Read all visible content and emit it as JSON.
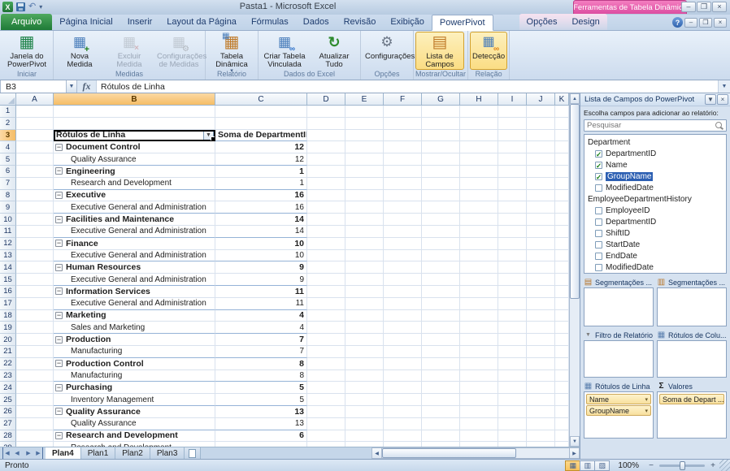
{
  "titlebar": {
    "title": "Pasta1 - Microsoft Excel",
    "contextual_label": "Ferramentas de Tabela Dinâmica"
  },
  "tabs": {
    "file_label": "Arquivo",
    "items": [
      "Página Inicial",
      "Inserir",
      "Layout da Página",
      "Fórmulas",
      "Dados",
      "Revisão",
      "Exibição",
      "PowerPivot"
    ],
    "active": "PowerPivot",
    "contextual_items": [
      "Opções",
      "Design"
    ]
  },
  "ribbon": {
    "groups": [
      {
        "label": "Iniciar",
        "buttons": [
          {
            "label": "Janela do PowerPivot",
            "icon": "powerpivot-window-icon"
          }
        ]
      },
      {
        "label": "Medidas",
        "buttons": [
          {
            "label": "Nova Medida",
            "icon": "new-measure-icon"
          },
          {
            "label": "Excluir Medida",
            "icon": "delete-measure-icon",
            "disabled": true
          },
          {
            "label": "Configurações de Medidas",
            "icon": "measure-settings-icon",
            "disabled": true
          }
        ]
      },
      {
        "label": "Relatório",
        "buttons": [
          {
            "label": "Tabela Dinâmica",
            "icon": "pivot-table-icon",
            "dropdown": true
          }
        ]
      },
      {
        "label": "Dados do Excel",
        "buttons": [
          {
            "label": "Criar Tabela Vinculada",
            "icon": "linked-table-icon"
          },
          {
            "label": "Atualizar Tudo",
            "icon": "refresh-all-icon"
          }
        ]
      },
      {
        "label": "Opções",
        "buttons": [
          {
            "label": "Configurações",
            "icon": "settings-icon"
          }
        ]
      },
      {
        "label": "Mostrar/Ocultar",
        "buttons": [
          {
            "label": "Lista de Campos",
            "icon": "field-list-icon",
            "active": true
          }
        ]
      },
      {
        "label": "Relação",
        "buttons": [
          {
            "label": "Detecção",
            "icon": "detection-icon",
            "active": true
          }
        ]
      }
    ]
  },
  "formula_bar": {
    "name_box": "B3",
    "fx_label": "fx",
    "value": "Rótulos de Linha"
  },
  "grid": {
    "columns": [
      "A",
      "B",
      "C",
      "D",
      "E",
      "F",
      "G",
      "H",
      "I",
      "J",
      "K"
    ],
    "selected_column": "B",
    "selected_row": 3,
    "visible_rows": 29,
    "pivot": {
      "header_row": 3,
      "header": {
        "row_label": "Rótulos de Linha",
        "value_label": "Soma de DepartmentID"
      },
      "rows": [
        {
          "type": "group",
          "label": "Document Control",
          "value": "12"
        },
        {
          "type": "detail",
          "label": "Quality Assurance",
          "value": "12"
        },
        {
          "type": "group",
          "label": "Engineering",
          "value": "1"
        },
        {
          "type": "detail",
          "label": "Research and Development",
          "value": "1"
        },
        {
          "type": "group",
          "label": "Executive",
          "value": "16"
        },
        {
          "type": "detail",
          "label": "Executive General and Administration",
          "value": "16"
        },
        {
          "type": "group",
          "label": "Facilities and Maintenance",
          "value": "14"
        },
        {
          "type": "detail",
          "label": "Executive General and Administration",
          "value": "14"
        },
        {
          "type": "group",
          "label": "Finance",
          "value": "10"
        },
        {
          "type": "detail",
          "label": "Executive General and Administration",
          "value": "10"
        },
        {
          "type": "group",
          "label": "Human Resources",
          "value": "9"
        },
        {
          "type": "detail",
          "label": "Executive General and Administration",
          "value": "9"
        },
        {
          "type": "group",
          "label": "Information Services",
          "value": "11"
        },
        {
          "type": "detail",
          "label": "Executive General and Administration",
          "value": "11"
        },
        {
          "type": "group",
          "label": "Marketing",
          "value": "4"
        },
        {
          "type": "detail",
          "label": "Sales and Marketing",
          "value": "4"
        },
        {
          "type": "group",
          "label": "Production",
          "value": "7"
        },
        {
          "type": "detail",
          "label": "Manufacturing",
          "value": "7"
        },
        {
          "type": "group",
          "label": "Production Control",
          "value": "8"
        },
        {
          "type": "detail",
          "label": "Manufacturing",
          "value": "8"
        },
        {
          "type": "group",
          "label": "Purchasing",
          "value": "5"
        },
        {
          "type": "detail",
          "label": "Inventory Management",
          "value": "5"
        },
        {
          "type": "group",
          "label": "Quality Assurance",
          "value": "13"
        },
        {
          "type": "detail",
          "label": "Quality Assurance",
          "value": "13"
        },
        {
          "type": "group",
          "label": "Research and Development",
          "value": "6"
        },
        {
          "type": "detail",
          "label": "Research and Development",
          "value": ""
        }
      ]
    }
  },
  "field_list": {
    "title": "Lista de Campos do PowerPivot",
    "instruction": "Escolha campos para adicionar ao relatório:",
    "search_placeholder": "Pesquisar",
    "tables": [
      {
        "name": "Department",
        "fields": [
          {
            "name": "DepartmentID",
            "checked": true
          },
          {
            "name": "Name",
            "checked": true
          },
          {
            "name": "GroupName",
            "checked": true,
            "selected": true
          },
          {
            "name": "ModifiedDate",
            "checked": false
          }
        ]
      },
      {
        "name": "EmployeeDepartmentHistory",
        "fields": [
          {
            "name": "EmployeeID",
            "checked": false
          },
          {
            "name": "DepartmentID",
            "checked": false
          },
          {
            "name": "ShiftID",
            "checked": false
          },
          {
            "name": "StartDate",
            "checked": false
          },
          {
            "name": "EndDate",
            "checked": false
          },
          {
            "name": "ModifiedDate",
            "checked": false
          }
        ]
      }
    ],
    "areas": [
      {
        "label": "Segmentações ...",
        "icon": "slicer-vertical-icon",
        "items": []
      },
      {
        "label": "Segmentações ...",
        "icon": "slicer-horizontal-icon",
        "items": []
      },
      {
        "label": "Filtro de Relatório",
        "icon": "report-filter-icon",
        "items": []
      },
      {
        "label": "Rótulos de Colu...",
        "icon": "column-labels-icon",
        "items": []
      },
      {
        "label": "Rótulos de Linha",
        "icon": "row-labels-icon",
        "items": [
          "Name",
          "GroupName"
        ]
      },
      {
        "label": "Valores",
        "icon": "sum-values-icon",
        "items": [
          "Soma de Depart ..."
        ]
      }
    ]
  },
  "sheet_bar": {
    "tabs": [
      "Plan4",
      "Plan1",
      "Plan2",
      "Plan3"
    ],
    "active": "Plan4"
  },
  "status_bar": {
    "ready_label": "Pronto",
    "zoom_value": "100%"
  }
}
